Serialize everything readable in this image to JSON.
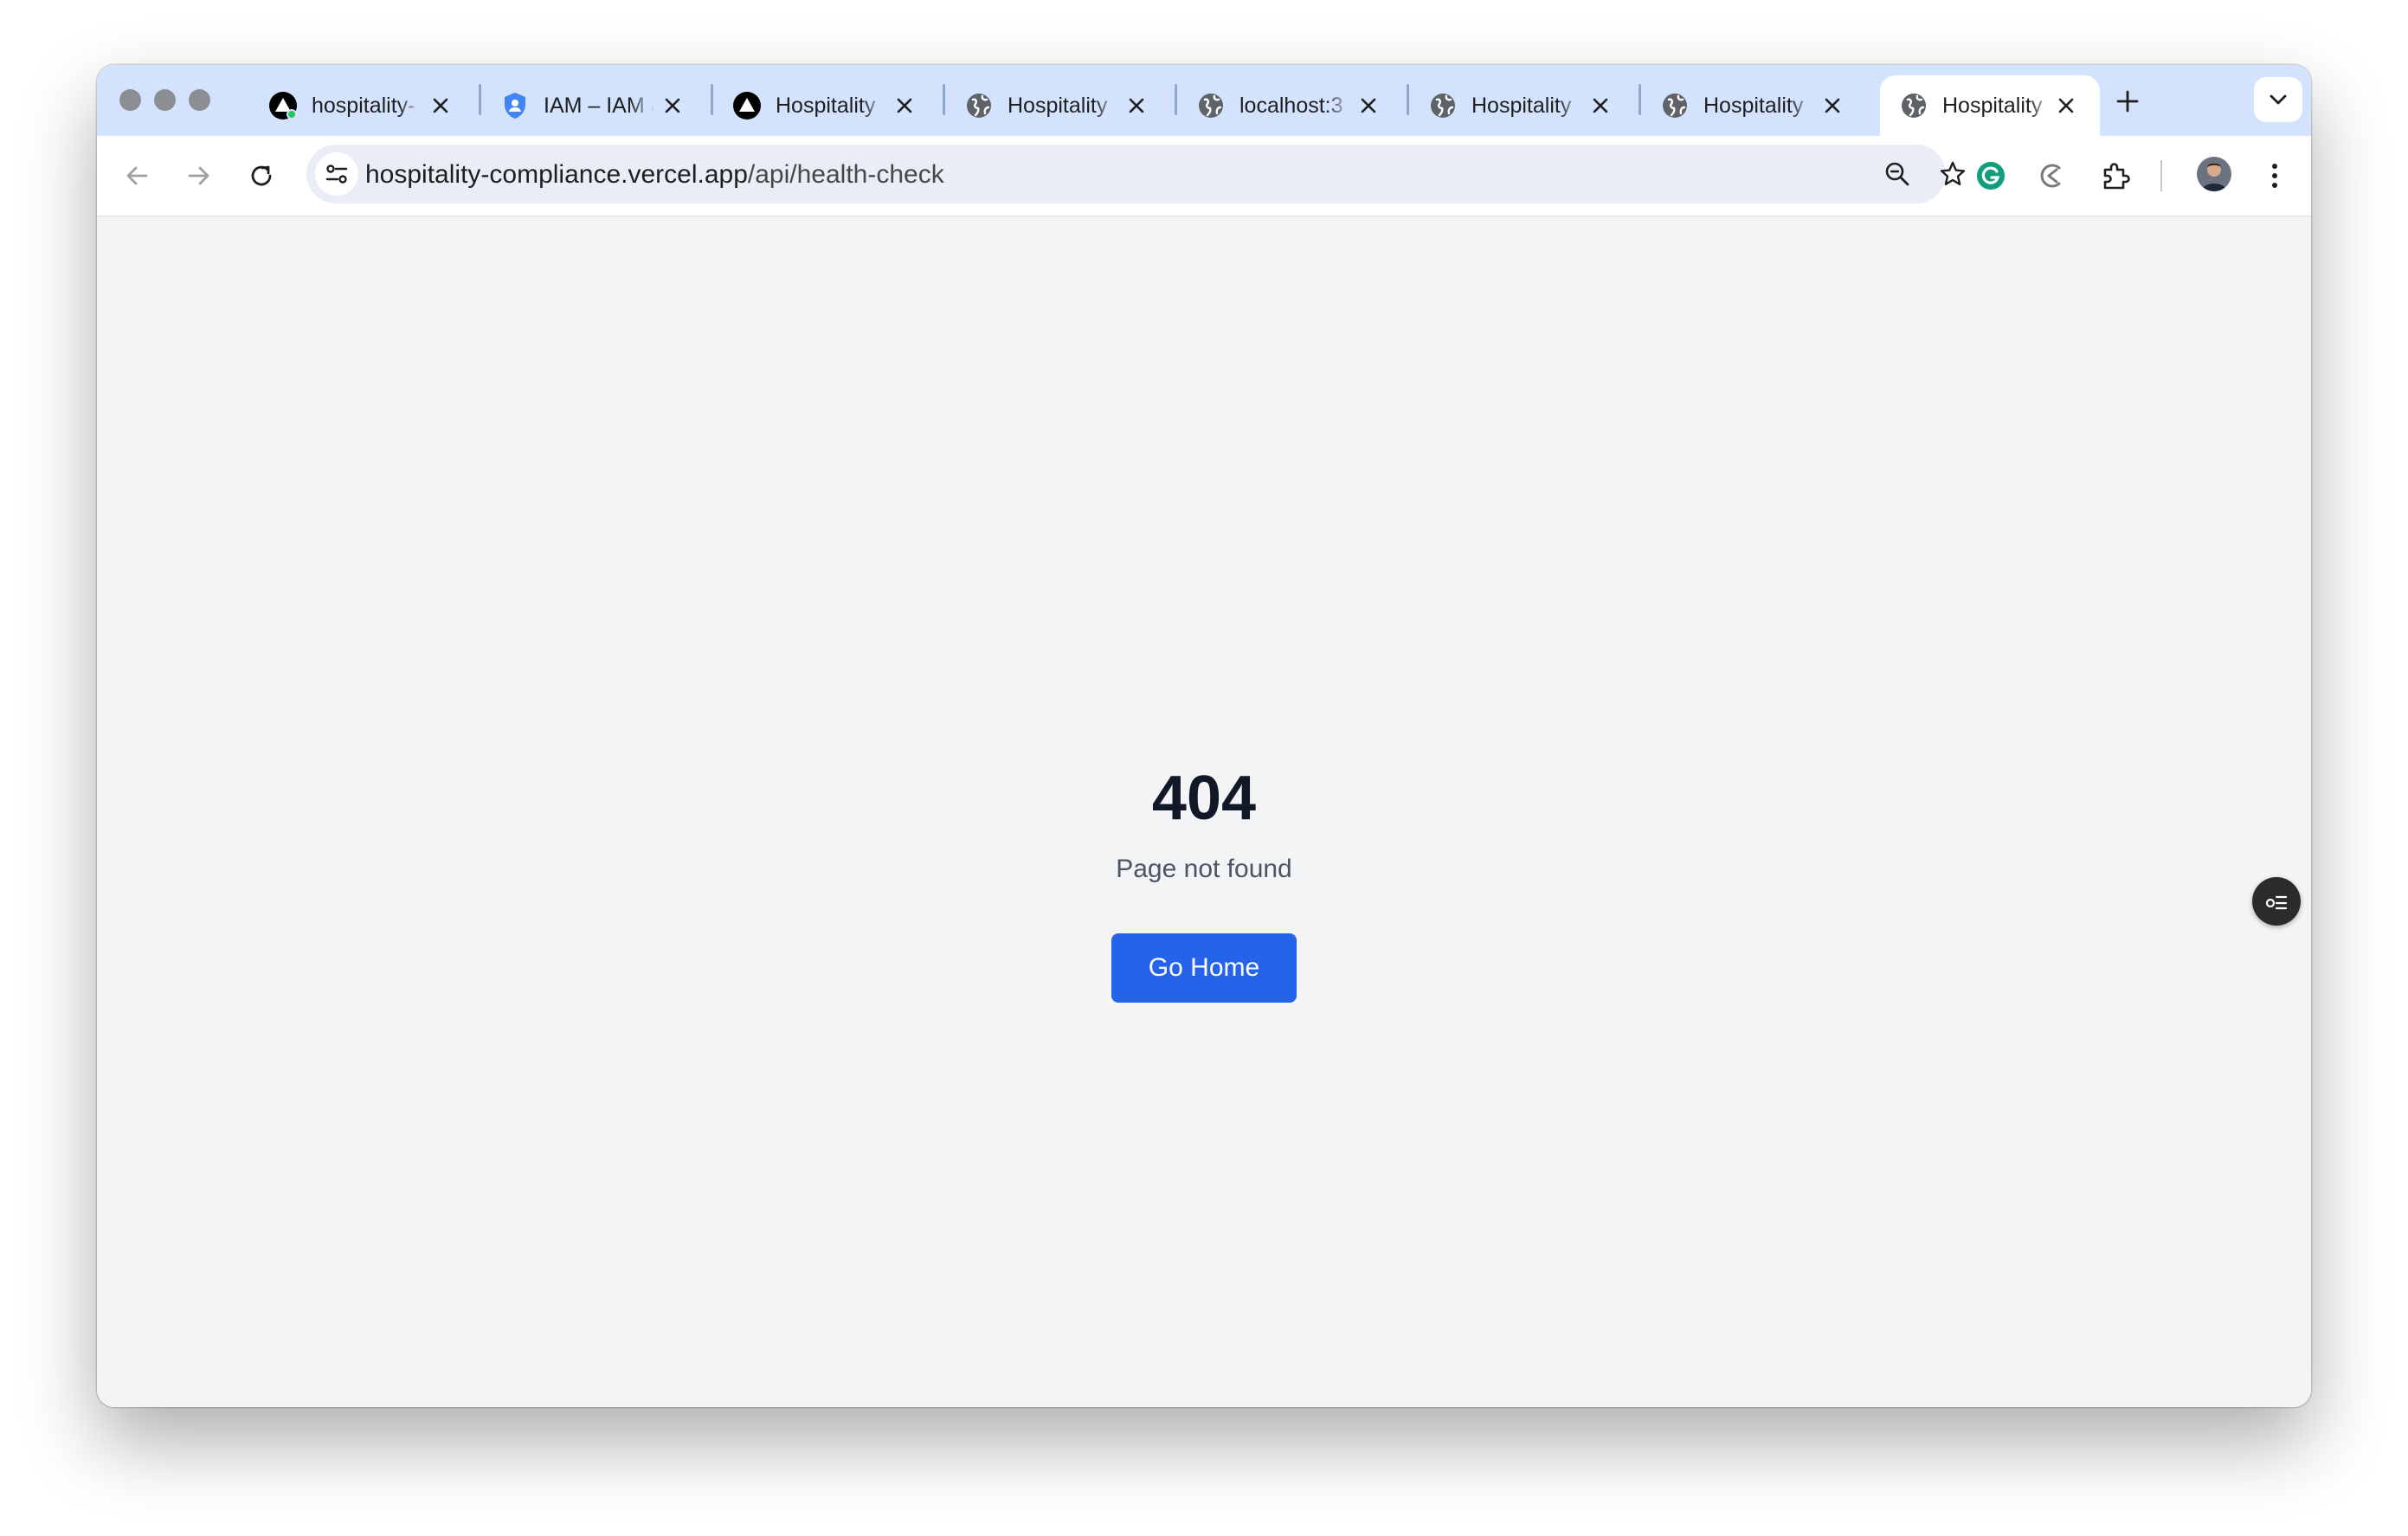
{
  "browser": {
    "tabs": [
      {
        "title": "hospitality-",
        "icon": "vercel-triangle-icon"
      },
      {
        "title": "IAM – IAM &",
        "icon": "shield-icon"
      },
      {
        "title": "Hospitality",
        "icon": "vercel-triangle-icon"
      },
      {
        "title": "Hospitality",
        "icon": "globe-icon"
      },
      {
        "title": "localhost:3",
        "icon": "globe-icon"
      },
      {
        "title": "Hospitality",
        "icon": "globe-icon"
      },
      {
        "title": "Hospitality",
        "icon": "globe-icon"
      },
      {
        "title": "Hospitality",
        "icon": "globe-icon",
        "active": true
      }
    ],
    "address": {
      "host": "hospitality-compliance.vercel.app",
      "path": "/api/health-check"
    },
    "colors": {
      "tabbar": "#d3e3fd",
      "grammarly": "#15c39a"
    }
  },
  "page": {
    "code": "404",
    "message": "Page not found",
    "button_label": "Go Home",
    "button_color": "#2563eb"
  }
}
